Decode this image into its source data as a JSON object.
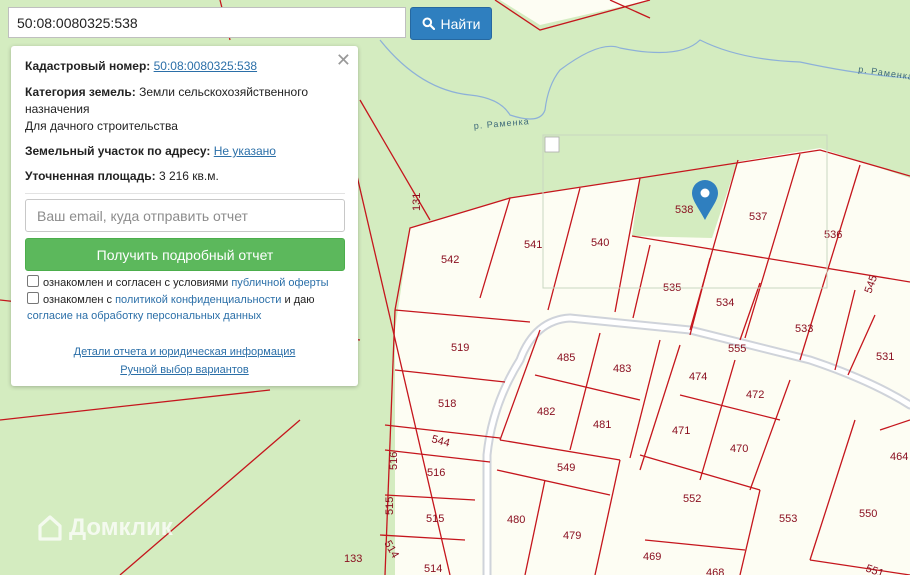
{
  "search": {
    "value": "50:08:0080325:538",
    "button_label": "Найти"
  },
  "info": {
    "cadastral_label": "Кадастровый номер:",
    "cadastral_value": "50:08:0080325:538",
    "category_label": "Категория земель:",
    "category_value": "Земли сельскохозяйственного назначения",
    "usage_value": "Для дачного строительства",
    "address_label": "Земельный участок по адресу:",
    "address_value": "Не указано",
    "area_label": "Уточненная площадь:",
    "area_value": "3 216 кв.м.",
    "email_placeholder": "Ваш email, куда отправить отчет",
    "report_button": "Получить подробный отчет",
    "consent1_text": "ознакомлен и согласен с условиями",
    "consent1_link": "публичной оферты",
    "consent2_text": "ознакомлен с",
    "consent2_link": "политикой конфиденциальности",
    "consent2_mid": "и даю",
    "consent2_link2": "согласие на обработку персональных данных",
    "details_link": "Детали отчета и юридическая информация",
    "manual_link": "Ручной выбор вариантов"
  },
  "map": {
    "river_label": "р. Раменка",
    "watermark": "Домклик",
    "plots": [
      "538",
      "537",
      "536",
      "542",
      "541",
      "540",
      "535",
      "534",
      "533",
      "531",
      "545",
      "555",
      "519",
      "485",
      "483",
      "474",
      "472",
      "518",
      "482",
      "481",
      "471",
      "470",
      "544",
      "516",
      "549",
      "552",
      "464",
      "515",
      "480",
      "479",
      "553",
      "550",
      "514",
      "469",
      "468",
      "551",
      "131",
      "133"
    ]
  },
  "colors": {
    "forest": "#d4ecc0",
    "plot": "#fdfdf3",
    "border": "#c5161d",
    "road": "#dadde3",
    "button": "#2f7fbf",
    "report": "#5cb85c"
  }
}
